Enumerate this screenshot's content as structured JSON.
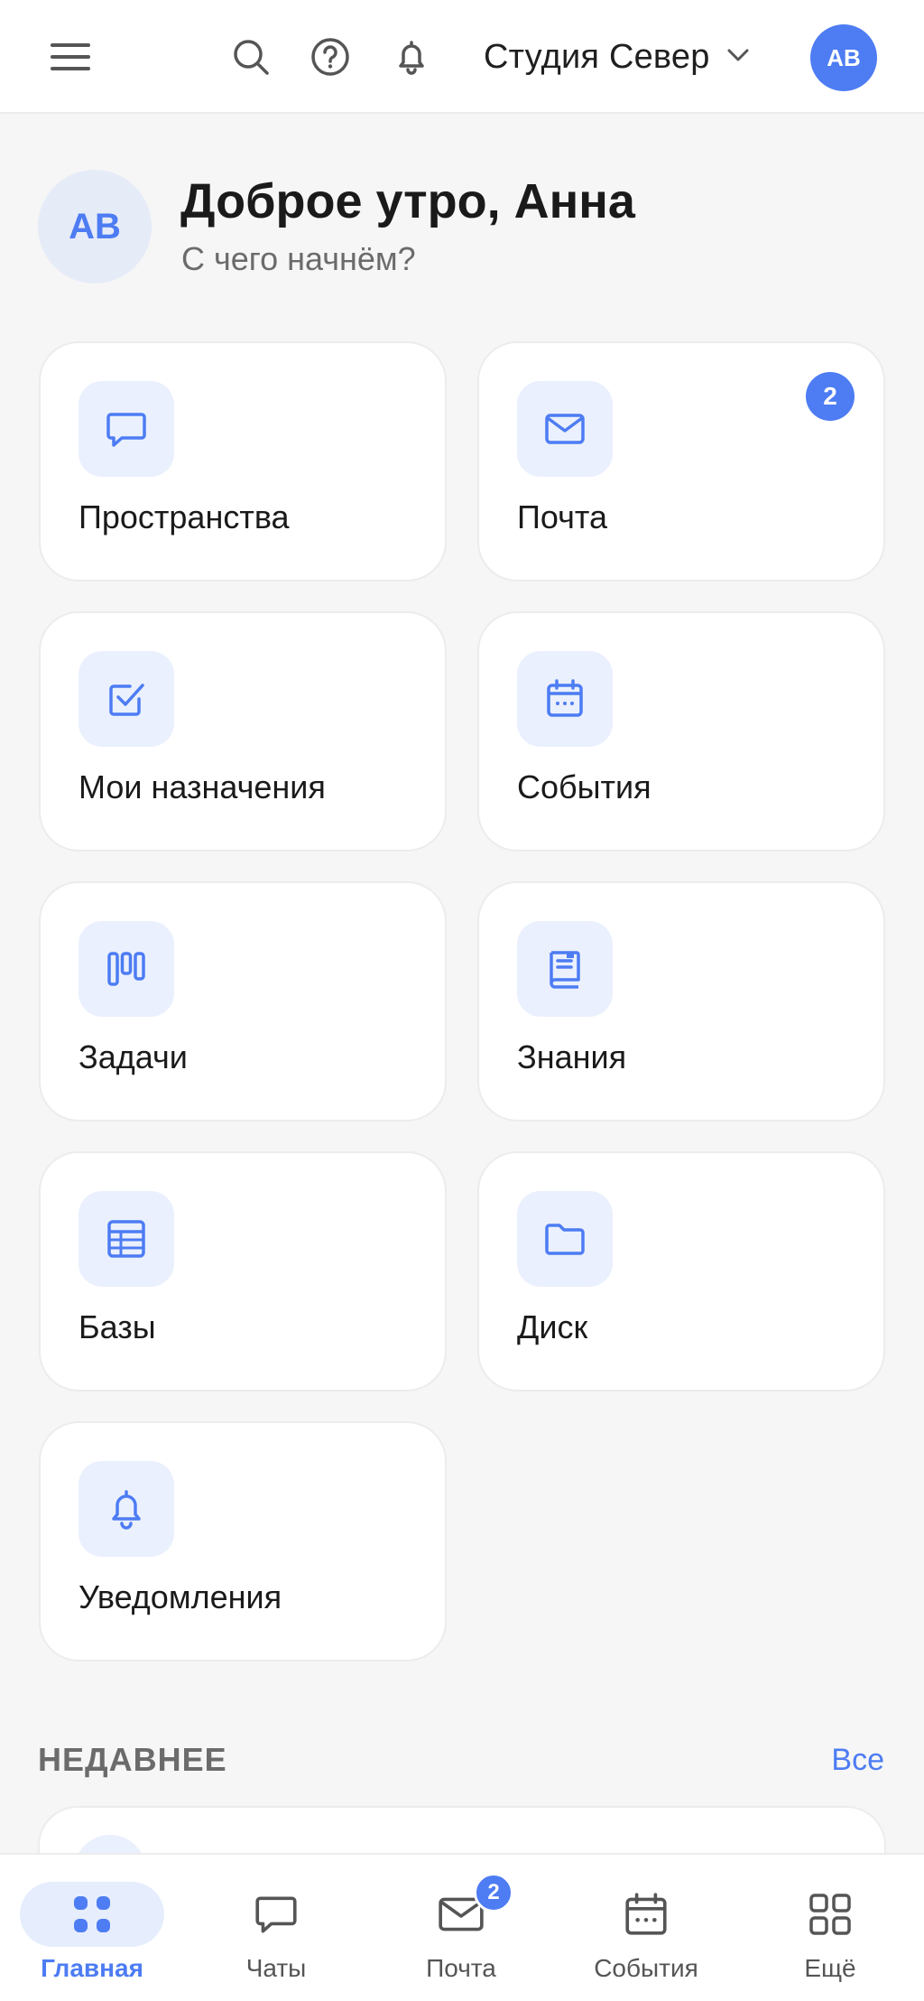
{
  "header": {
    "workspace_name": "Студия Север",
    "avatar_initials": "AB"
  },
  "greeting": {
    "avatar_initials": "AB",
    "title": "Доброе утро, Анна",
    "subtitle": "С чего начнём?"
  },
  "tiles": [
    {
      "label": "Пространства",
      "icon": "chat-bubble-icon"
    },
    {
      "label": "Почта",
      "icon": "mail-icon",
      "badge": "2"
    },
    {
      "label": "Мои назначения",
      "icon": "checkbox-icon"
    },
    {
      "label": "События",
      "icon": "calendar-icon"
    },
    {
      "label": "Задачи",
      "icon": "kanban-icon"
    },
    {
      "label": "Знания",
      "icon": "book-icon"
    },
    {
      "label": "Базы",
      "icon": "table-icon"
    },
    {
      "label": "Диск",
      "icon": "folder-icon"
    },
    {
      "label": "Уведомления",
      "icon": "bell-icon"
    }
  ],
  "recent": {
    "title": "НЕДАВНЕЕ",
    "all_link": "Все"
  },
  "bottom_nav": [
    {
      "label": "Главная",
      "icon": "grid-dots-icon",
      "active": true
    },
    {
      "label": "Чаты",
      "icon": "chat-bubble-icon"
    },
    {
      "label": "Почта",
      "icon": "mail-icon",
      "badge": "2"
    },
    {
      "label": "События",
      "icon": "calendar-icon"
    },
    {
      "label": "Ещё",
      "icon": "grid-squares-icon"
    }
  ],
  "colors": {
    "accent": "#4d7cf3",
    "icon_bg": "#eaf0fd",
    "page_bg": "#f6f6f6"
  }
}
